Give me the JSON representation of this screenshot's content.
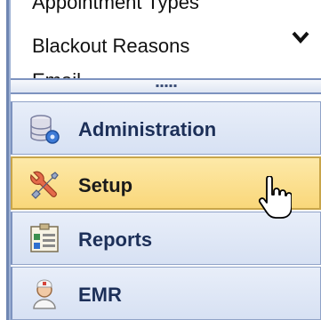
{
  "list": {
    "items": [
      "Appointment Types",
      "Blackout Reasons",
      "Email"
    ]
  },
  "icons": {
    "chevron": "chevron-down-icon",
    "administration": "database-gear-icon",
    "setup": "wrench-screwdriver-icon",
    "reports": "report-board-icon",
    "emr": "doctor-icon",
    "cursor": "hand-pointer-cursor"
  },
  "nav": {
    "items": [
      {
        "label": "Administration"
      },
      {
        "label": "Setup",
        "active": true
      },
      {
        "label": "Reports"
      },
      {
        "label": "EMR"
      }
    ]
  },
  "colors": {
    "nav_bg": "#dbe4f4",
    "active_bg": "#fbe08a",
    "nav_border": "#7d93bf",
    "label_text": "#1c2f58"
  }
}
